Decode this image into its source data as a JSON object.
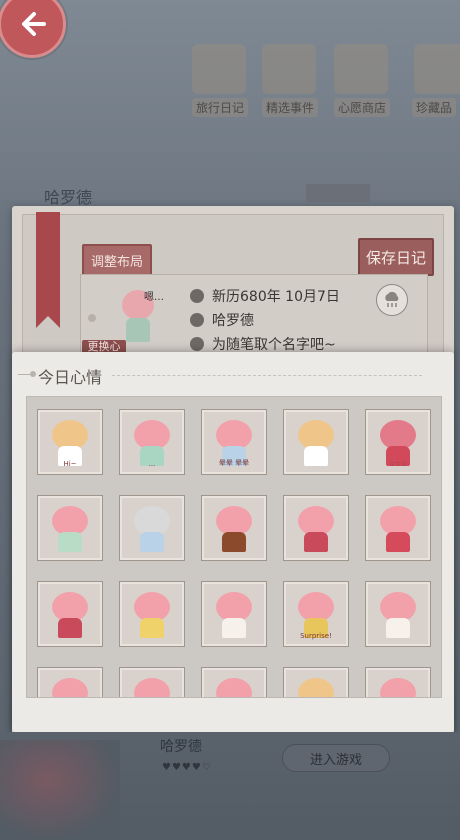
{
  "top_menu": [
    {
      "label": "旅行日记"
    },
    {
      "label": "精选事件"
    },
    {
      "label": "心愿商店"
    },
    {
      "label": "珍藏品"
    }
  ],
  "background": {
    "name": "哈罗德",
    "bottom_name": "哈罗德",
    "bottom_button": "进入游戏",
    "hearts": "♥♥♥♥♡"
  },
  "diary": {
    "adjust_label": "调整布局",
    "save_label": "保存日记",
    "more_label": "更换心",
    "date": "新历680年 10月7日",
    "author": "哈罗德",
    "title_prompt": "为随笔取个名字吧~",
    "emote": "嗯…"
  },
  "mood_panel": {
    "title": "今日心情",
    "stickers": [
      {
        "name": "sticker-cat-cheer",
        "text": "Hi~",
        "hair": "#f0c58a",
        "cloth": "#ffffff"
      },
      {
        "name": "sticker-girl-sitting",
        "text": "...",
        "hair": "#f2a1ab",
        "cloth": "#a8d6c3"
      },
      {
        "name": "sticker-girl-dizzy",
        "text": "晕晕 晕晕",
        "hair": "#f2a1ab",
        "cloth": "#b9d2e8"
      },
      {
        "name": "sticker-cat-laugh",
        "text": "",
        "hair": "#f0c58a",
        "cloth": "#ffffff"
      },
      {
        "name": "sticker-girl-sparkle",
        "text": "☆☆☆",
        "hair": "#e37a8a",
        "cloth": "#d24a5a"
      },
      {
        "name": "sticker-girl-standing",
        "text": "",
        "hair": "#f2a1ab",
        "cloth": "#b8dcc6"
      },
      {
        "name": "sticker-girl-whisper",
        "text": "",
        "hair": "#d9d9d9",
        "cloth": "#b9d2e8"
      },
      {
        "name": "sticker-girl-eating",
        "text": "",
        "hair": "#f2a1ab",
        "cloth": "#8b4a2b"
      },
      {
        "name": "sticker-girl-shy",
        "text": "",
        "hair": "#f2a1ab",
        "cloth": "#c94a5a"
      },
      {
        "name": "sticker-girl-cat-hug",
        "text": "",
        "hair": "#f2a1ab",
        "cloth": "#d64b5b"
      },
      {
        "name": "sticker-girl-cheer",
        "text": "",
        "hair": "#f2a1ab",
        "cloth": "#c94a5a"
      },
      {
        "name": "sticker-girl-flower",
        "text": "",
        "hair": "#f2a1ab",
        "cloth": "#f0d26a"
      },
      {
        "name": "sticker-girl-cake",
        "text": "",
        "hair": "#f2a1ab",
        "cloth": "#f6f1ea"
      },
      {
        "name": "sticker-girl-surprise",
        "text": "Surprise!",
        "hair": "#f2a1ab",
        "cloth": "#e8c65c"
      },
      {
        "name": "sticker-girl-crown",
        "text": "",
        "hair": "#f2a1ab",
        "cloth": "#f6f1ea"
      },
      {
        "name": "sticker-girl-wave",
        "text": "",
        "hair": "#f2a1ab",
        "cloth": "#d9d2cc"
      },
      {
        "name": "sticker-girl-peek",
        "text": "",
        "hair": "#f2a1ab",
        "cloth": "#d9d2cc"
      },
      {
        "name": "sticker-girl-sleep",
        "text": "",
        "hair": "#f2a1ab",
        "cloth": "#d9d2cc"
      },
      {
        "name": "sticker-cat-peek",
        "text": "",
        "hair": "#f0c58a",
        "cloth": "#ffffff"
      },
      {
        "name": "sticker-girl-smile",
        "text": "",
        "hair": "#f2a1ab",
        "cloth": "#d9d2cc"
      }
    ]
  }
}
